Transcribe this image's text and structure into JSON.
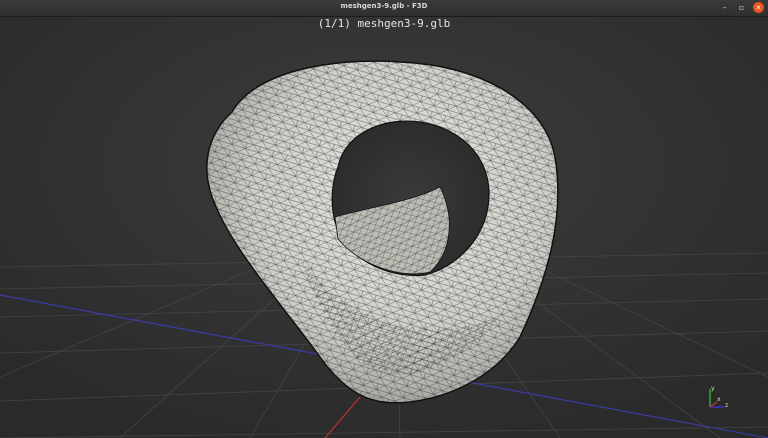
{
  "window": {
    "title": "meshgen3-9.glb - F3D",
    "buttons": {
      "minimize": "–",
      "maximize": "▫",
      "close": "✕"
    }
  },
  "viewer": {
    "file_label": "(1/1) meshgen3-9.glb",
    "axes": {
      "x": "x",
      "y": "y",
      "z": "z"
    }
  },
  "colors": {
    "background": "#333333",
    "grid": "#4a4a4a",
    "x_axis": "#c03030",
    "z_axis": "#3a3aa8",
    "mesh_fill": "#dcdcd6",
    "mesh_lines": "#1a1a1a"
  }
}
